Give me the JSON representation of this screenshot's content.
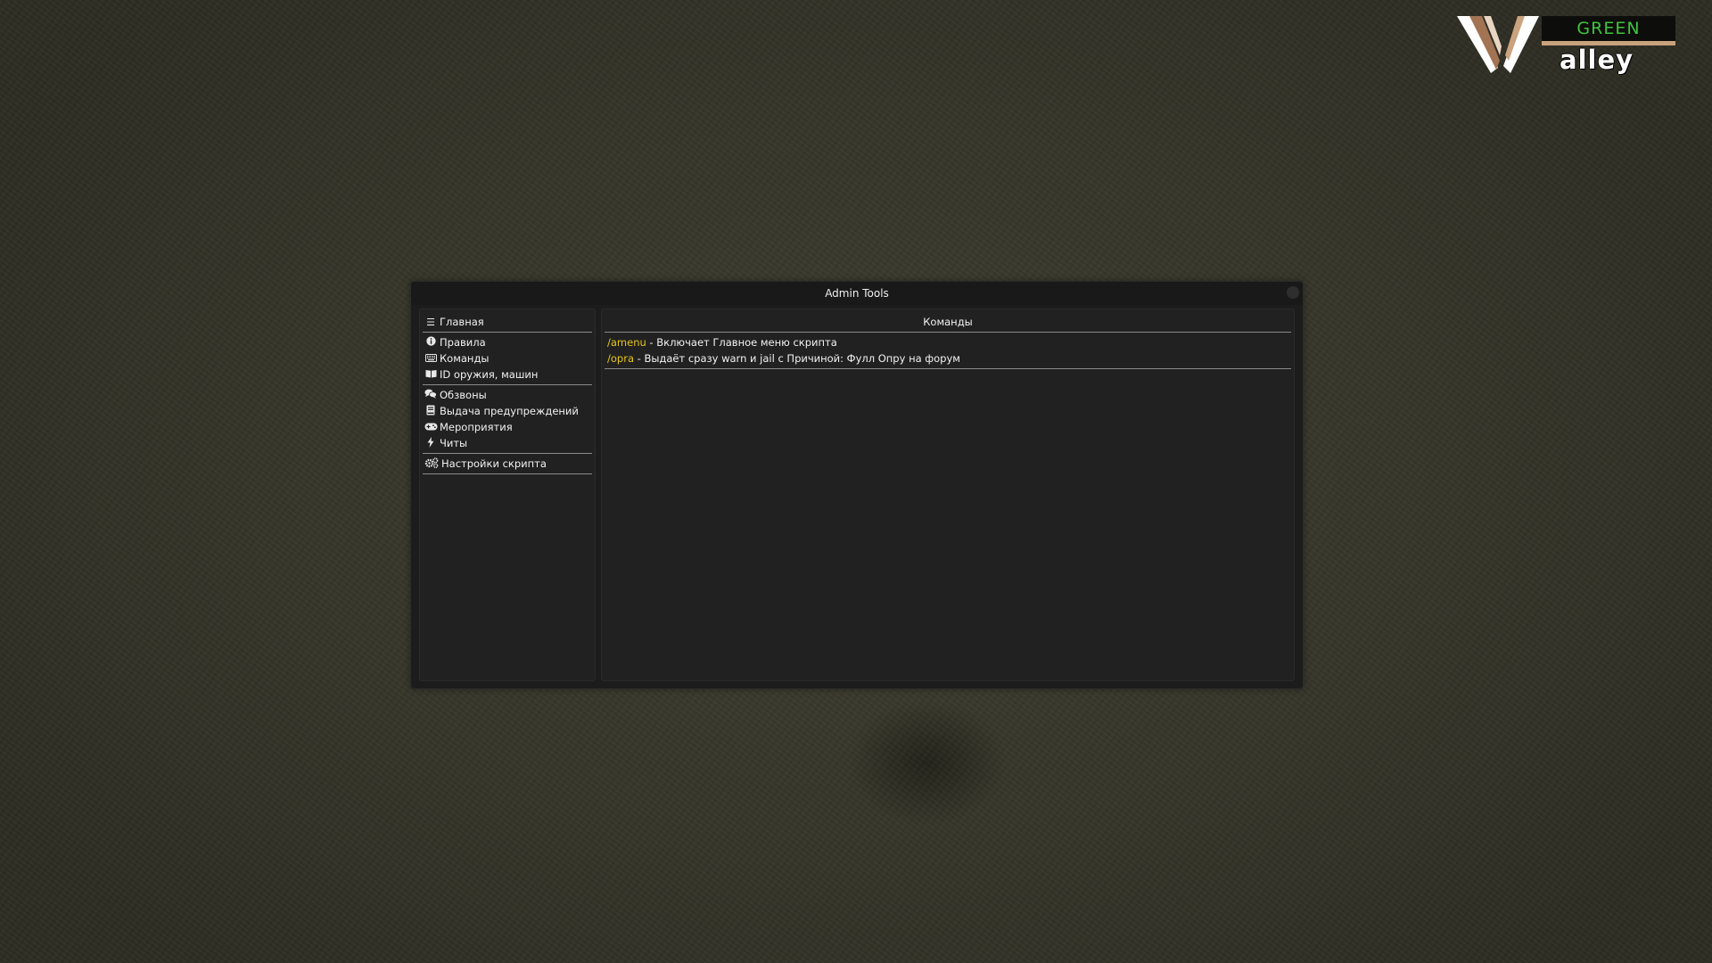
{
  "logo": {
    "green_text": "GREEN",
    "alley_text": "alley",
    "green_color": "#3fc43b",
    "accent_color": "#c9a27e"
  },
  "window": {
    "title": "Admin Tools"
  },
  "sidebar": {
    "home": {
      "label": "Главная",
      "icon": "menu-icon"
    },
    "items": [
      {
        "label": "Правила",
        "icon": "info-icon"
      },
      {
        "label": "Команды",
        "icon": "keyboard-icon"
      },
      {
        "label": "ID оружия, машин",
        "icon": "book-icon"
      },
      {
        "label": "Обзвоны",
        "icon": "comments-icon"
      },
      {
        "label": "Выдача предупреждений",
        "icon": "book-notebook-icon"
      },
      {
        "label": "Мероприятия",
        "icon": "gamepad-icon"
      },
      {
        "label": "Читы",
        "icon": "bolt-icon"
      },
      {
        "label": "Настройки скрипта",
        "icon": "gears-icon"
      }
    ]
  },
  "content": {
    "header": "Команды",
    "commands": [
      {
        "name": "/amenu",
        "description": " - Включает Главное меню скрипта"
      },
      {
        "name": "/opra",
        "description": " - Выдаёт сразу warn и jail с Причиной: Фулл Опру на форум"
      }
    ],
    "command_color": "#e6c619"
  }
}
